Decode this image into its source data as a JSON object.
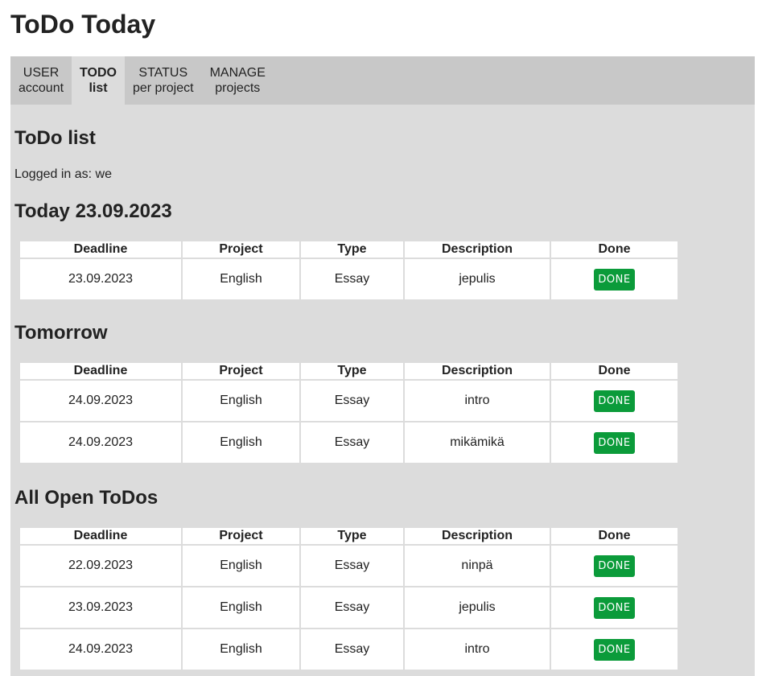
{
  "app": {
    "title": "ToDo Today"
  },
  "nav": {
    "tabs": [
      {
        "line1": "USER",
        "line2": "account"
      },
      {
        "line1": "TODO",
        "line2": "list"
      },
      {
        "line1": "STATUS",
        "line2": "per project"
      },
      {
        "line1": "MANAGE",
        "line2": "projects"
      }
    ],
    "active_tab": "TODO list"
  },
  "page": {
    "title": "ToDo list",
    "logged_in": "Logged in as: we"
  },
  "columns": {
    "deadline": "Deadline",
    "project": "Project",
    "type": "Type",
    "description": "Description",
    "done": "Done"
  },
  "done_label": "DONE",
  "colors": {
    "nav_bg": "#c8c8c8",
    "content_bg": "#dcdcdc",
    "done_button": "#0b9b3a"
  },
  "sections": {
    "today": {
      "title": "Today 23.09.2023",
      "rows": [
        {
          "deadline": "23.09.2023",
          "project": "English",
          "type": "Essay",
          "description": "jepulis"
        }
      ]
    },
    "tomorrow": {
      "title": "Tomorrow",
      "rows": [
        {
          "deadline": "24.09.2023",
          "project": "English",
          "type": "Essay",
          "description": "intro"
        },
        {
          "deadline": "24.09.2023",
          "project": "English",
          "type": "Essay",
          "description": "mikämikä"
        }
      ]
    },
    "all_open": {
      "title": "All Open ToDos",
      "rows": [
        {
          "deadline": "22.09.2023",
          "project": "English",
          "type": "Essay",
          "description": "ninpä"
        },
        {
          "deadline": "23.09.2023",
          "project": "English",
          "type": "Essay",
          "description": "jepulis"
        },
        {
          "deadline": "24.09.2023",
          "project": "English",
          "type": "Essay",
          "description": "intro"
        }
      ]
    }
  }
}
